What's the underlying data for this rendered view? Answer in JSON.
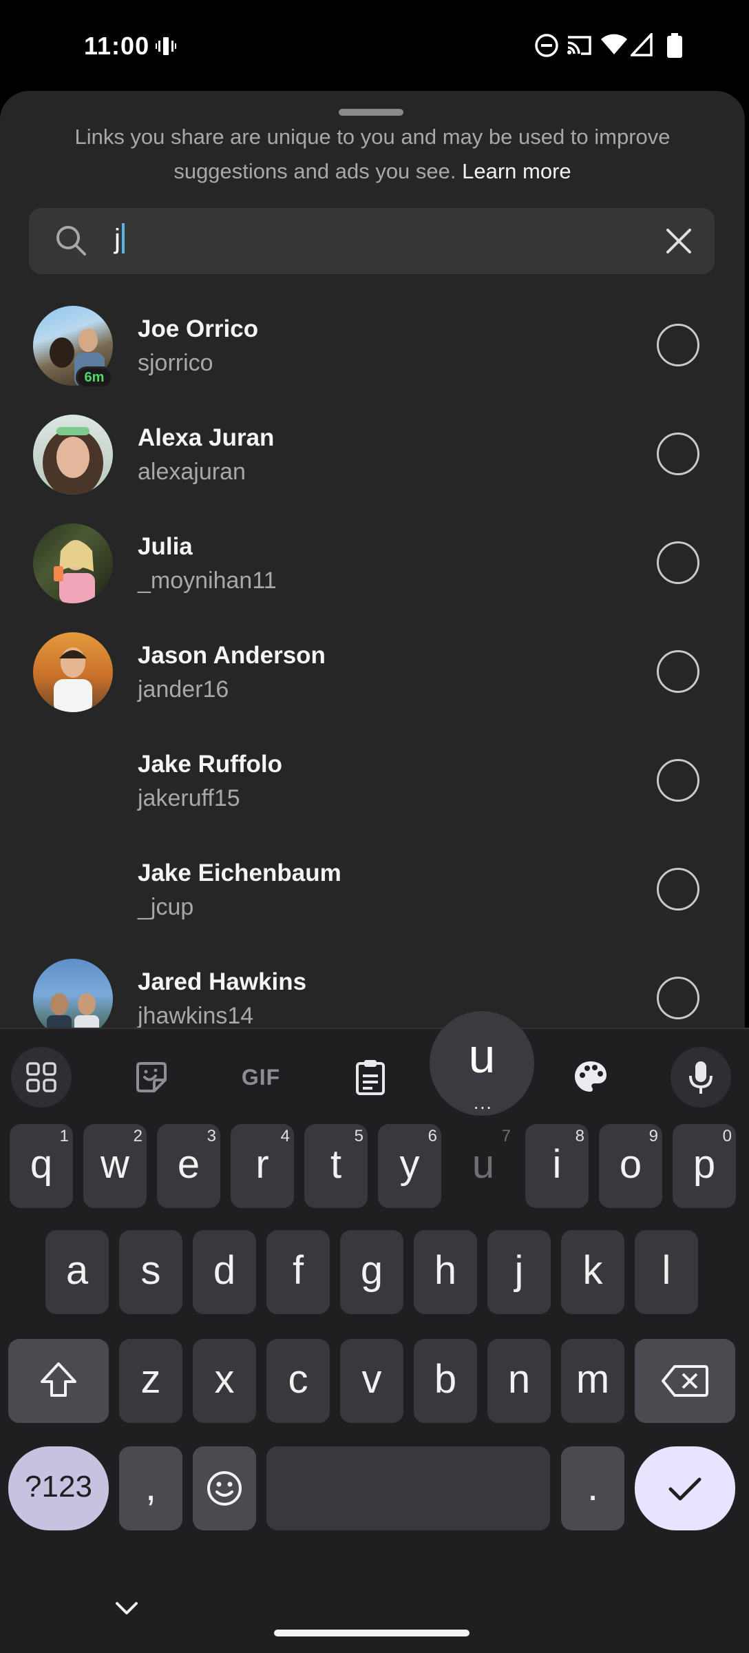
{
  "status_bar": {
    "time": "11:00",
    "icons": [
      "vibrate-icon",
      "do-not-disturb-icon",
      "cast-icon",
      "wifi-icon",
      "signal-icon",
      "battery-icon"
    ]
  },
  "share_sheet": {
    "notice_text": "Links you share are unique to you and may be used to improve suggestions and ads you see.",
    "learn_more": "Learn more",
    "search": {
      "value": "j",
      "icon": "search-icon",
      "clear_icon": "close-icon"
    },
    "contacts": [
      {
        "name": "Joe Orrico",
        "username": "sjorrico",
        "badge": "6m",
        "has_avatar": true
      },
      {
        "name": "Alexa Juran",
        "username": "alexajuran",
        "has_avatar": true
      },
      {
        "name": "Julia",
        "username": "_moynihan11",
        "has_avatar": true
      },
      {
        "name": "Jason Anderson",
        "username": "jander16",
        "has_avatar": true
      },
      {
        "name": "Jake Ruffolo",
        "username": "jakeruff15",
        "has_avatar": false
      },
      {
        "name": "Jake Eichenbaum",
        "username": "_jcup",
        "has_avatar": false
      },
      {
        "name": "Jared Hawkins",
        "username": "jhawkins14",
        "has_avatar": true
      }
    ]
  },
  "keyboard": {
    "toolbar": {
      "gif_label": "GIF",
      "popup_char": "u",
      "popup_dots": "..."
    },
    "row1": [
      {
        "k": "q",
        "h": "1"
      },
      {
        "k": "w",
        "h": "2"
      },
      {
        "k": "e",
        "h": "3"
      },
      {
        "k": "r",
        "h": "4"
      },
      {
        "k": "t",
        "h": "5"
      },
      {
        "k": "y",
        "h": "6"
      },
      {
        "k": "u",
        "h": "7"
      },
      {
        "k": "i",
        "h": "8"
      },
      {
        "k": "o",
        "h": "9"
      },
      {
        "k": "p",
        "h": "0"
      }
    ],
    "row2": [
      "a",
      "s",
      "d",
      "f",
      "g",
      "h",
      "j",
      "k",
      "l"
    ],
    "row3": [
      "z",
      "x",
      "c",
      "v",
      "b",
      "n",
      "m"
    ],
    "symbols_label": "?123",
    "comma": ",",
    "period": "."
  }
}
